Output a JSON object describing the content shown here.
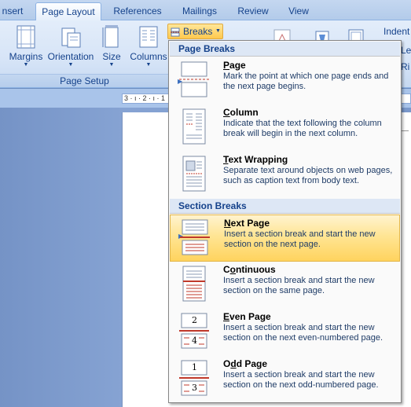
{
  "tabs": [
    {
      "label": "nsert",
      "active": false
    },
    {
      "label": "Page Layout",
      "active": true
    },
    {
      "label": "References",
      "active": false
    },
    {
      "label": "Mailings",
      "active": false
    },
    {
      "label": "Review",
      "active": false
    },
    {
      "label": "View",
      "active": false
    }
  ],
  "ribbon": {
    "margins_label": "Margins",
    "orientation_label": "Orientation",
    "size_label": "Size",
    "columns_label": "Columns",
    "group_label": "Page Setup",
    "breaks_label": "Breaks",
    "indent_label": "Indent",
    "le_label": "Le",
    "ri_label": "Ri"
  },
  "ruler": {
    "text": "3 · ı · 2 · ı · 1"
  },
  "menu": {
    "page_breaks_header": "Page Breaks",
    "section_breaks_header": "Section Breaks",
    "items": [
      {
        "title": "Page",
        "mnemonic": "P",
        "rest": "age",
        "desc": "Mark the point at which one page ends and the next page begins.",
        "icon": "page-break-icon"
      },
      {
        "title": "Column",
        "mnemonic": "C",
        "rest": "olumn",
        "desc": "Indicate that the text following the column break will begin in the next column.",
        "icon": "column-break-icon"
      },
      {
        "title": "Text Wrapping",
        "mnemonic": "T",
        "rest": "ext Wrapping",
        "desc": "Separate text around objects on web pages, such as caption text from body text.",
        "icon": "text-wrapping-break-icon"
      },
      {
        "title": "Next Page",
        "mnemonic": "N",
        "rest": "ext Page",
        "desc": "Insert a section break and start the new section on the next page.",
        "icon": "next-page-section-icon",
        "highlighted": true
      },
      {
        "title": "Continuous",
        "mnemonic": "o",
        "pre": "C",
        "rest": "ntinuous",
        "desc": "Insert a section break and start the new section on the same page.",
        "icon": "continuous-section-icon"
      },
      {
        "title": "Even Page",
        "mnemonic": "E",
        "rest": "ven Page",
        "desc": "Insert a section break and start the new section on the next even-numbered page.",
        "icon": "even-page-section-icon",
        "nums": [
          "2",
          "4"
        ]
      },
      {
        "title": "Odd Page",
        "mnemonic": "d",
        "pre": "O",
        "rest": "d Page",
        "desc": "Insert a section break and start the new section on the next odd-numbered page.",
        "icon": "odd-page-section-icon",
        "nums": [
          "1",
          "3"
        ]
      }
    ]
  },
  "colors": {
    "highlight": "#ffd35e",
    "accent": "#15428b",
    "menu_header_bg": "#dde7f5",
    "break_line": "#c0392b"
  }
}
